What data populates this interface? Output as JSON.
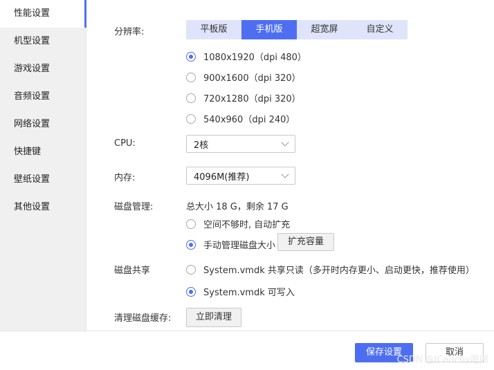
{
  "sidebar": {
    "items": [
      {
        "label": "性能设置",
        "active": true
      },
      {
        "label": "机型设置"
      },
      {
        "label": "游戏设置"
      },
      {
        "label": "音频设置"
      },
      {
        "label": "网络设置"
      },
      {
        "label": "快捷键"
      },
      {
        "label": "壁纸设置"
      },
      {
        "label": "其他设置"
      }
    ]
  },
  "resolution": {
    "label": "分辨率:",
    "tabs": [
      "平板版",
      "手机版",
      "超宽屏",
      "自定义"
    ],
    "selected_tab": "手机版",
    "options": [
      "1080x1920（dpi 480）",
      "900x1600（dpi 320）",
      "720x1280（dpi 320）",
      "540x960（dpi 240）"
    ],
    "selected_option": "1080x1920（dpi 480）"
  },
  "cpu": {
    "label": "CPU:",
    "value": "2核"
  },
  "memory": {
    "label": "内存:",
    "value": "4096M(推荐)"
  },
  "disk": {
    "label": "磁盘管理:",
    "info": "总大小 18 G，剩余 17 G",
    "options": [
      "空间不够时, 自动扩充",
      "手动管理磁盘大小"
    ],
    "selected": "手动管理磁盘大小",
    "expand_button": "扩充容量"
  },
  "share": {
    "label": "磁盘共享",
    "options": [
      "System.vmdk 共享只读（多开时内存更小、启动更快，推荐使用）",
      "System.vmdk 可写入"
    ],
    "selected": "System.vmdk 可写入"
  },
  "cache": {
    "label": "清理磁盘缓存:",
    "button": "立即清理"
  },
  "footer": {
    "save": "保存设置",
    "cancel": "取消",
    "watermark": "CSDN @ICauchy嗯嗯"
  },
  "colors": {
    "accent": "#4e6ef2",
    "tab_bg": "#dfe4fb"
  },
  "icons": [
    "chevron-down-icon",
    "radio-icon"
  ]
}
